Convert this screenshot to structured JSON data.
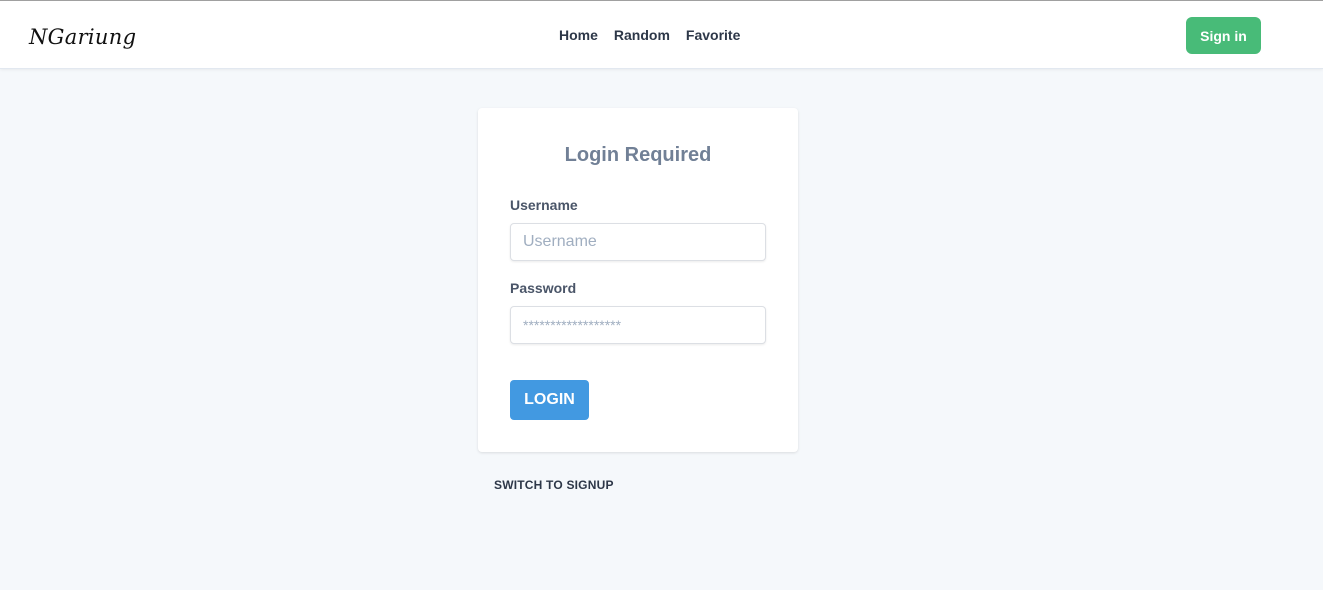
{
  "header": {
    "brand": "NGariung",
    "nav": [
      {
        "label": "Home"
      },
      {
        "label": "Random"
      },
      {
        "label": "Favorite"
      }
    ],
    "signin_label": "Sign in"
  },
  "login_card": {
    "title": "Login Required",
    "username": {
      "label": "Username",
      "placeholder": "Username",
      "value": ""
    },
    "password": {
      "label": "Password",
      "placeholder": "******************",
      "value": ""
    },
    "submit_label": "LOGIN"
  },
  "switch_link": "SWITCH TO SIGNUP",
  "colors": {
    "page_bg": "#f5f8fb",
    "signin_button": "#48bb78",
    "login_button": "#4299e1",
    "title_text": "#718096"
  }
}
